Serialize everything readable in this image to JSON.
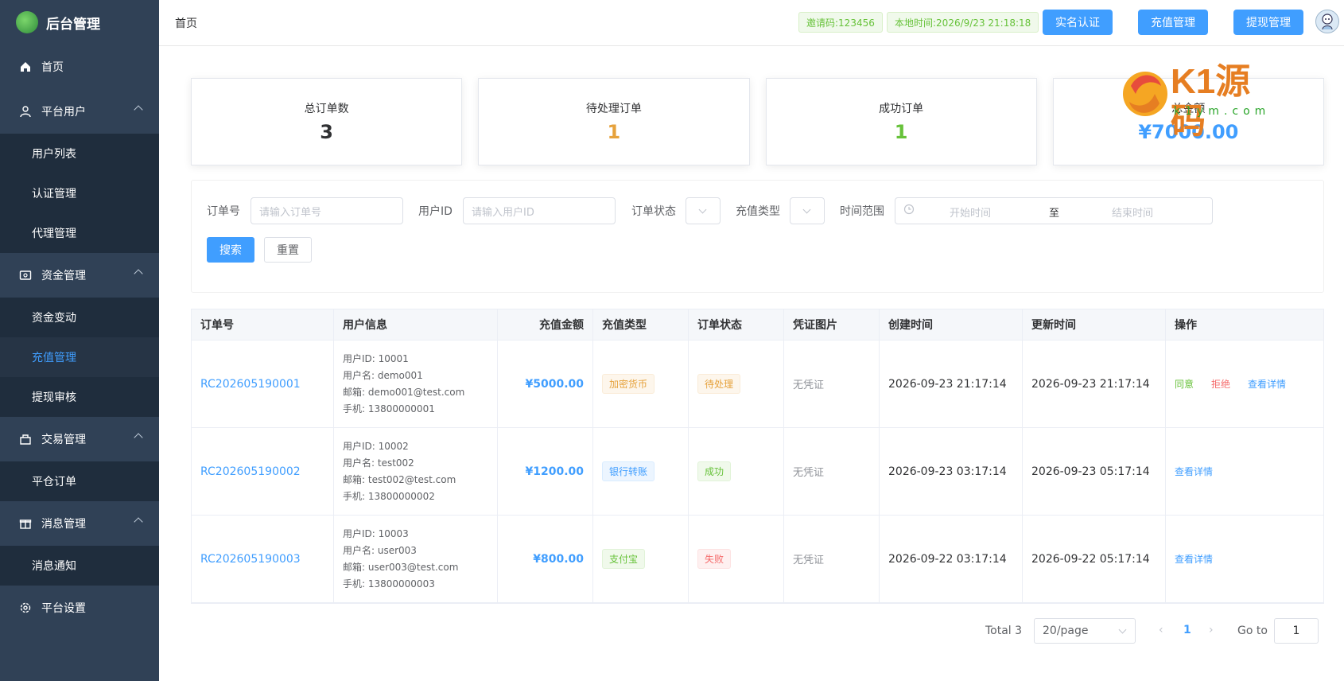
{
  "app": {
    "title": "后台管理"
  },
  "sidebar": {
    "items": [
      {
        "label": "首页"
      },
      {
        "label": "平台用户",
        "children": [
          "用户列表",
          "认证管理",
          "代理管理"
        ]
      },
      {
        "label": "资金管理",
        "children": [
          "资金变动",
          "充值管理",
          "提现审核"
        ]
      },
      {
        "label": "交易管理",
        "children": [
          "平仓订单"
        ]
      },
      {
        "label": "消息管理",
        "children": [
          "消息通知"
        ]
      },
      {
        "label": "平台设置"
      }
    ],
    "active": "充值管理"
  },
  "header": {
    "breadcrumb": "首页",
    "invite_code": "邀请码:123456",
    "local_time": "本地时间:2026/9/23 21:18:18",
    "buttons": {
      "verify": "实名认证",
      "recharge": "充值管理",
      "withdraw": "提现管理"
    }
  },
  "stats": [
    {
      "label": "总订单数",
      "value": "3",
      "color": "#303133"
    },
    {
      "label": "待处理订单",
      "value": "1",
      "color": "#e6a23c"
    },
    {
      "label": "成功订单",
      "value": "1",
      "color": "#67c23a"
    },
    {
      "label": "总金额",
      "value": "¥7000.00",
      "color": "#409eff"
    }
  ],
  "filters": {
    "order_no_label": "订单号",
    "order_no_placeholder": "请输入订单号",
    "user_id_label": "用户ID",
    "user_id_placeholder": "请输入用户ID",
    "status_label": "订单状态",
    "type_label": "充值类型",
    "time_label": "时间范围",
    "start_placeholder": "开始时间",
    "range_sep": "至",
    "end_placeholder": "结束时间",
    "search": "搜索",
    "reset": "重置"
  },
  "table": {
    "columns": [
      "订单号",
      "用户信息",
      "充值金额",
      "充值类型",
      "订单状态",
      "凭证图片",
      "创建时间",
      "更新时间",
      "操作"
    ],
    "rows": [
      {
        "order_no": "RC202605190001",
        "user_id": "用户ID: 10001",
        "username": "用户名: demo001",
        "email": "邮箱: demo001@test.com",
        "phone": "手机: 13800000001",
        "amount": "¥5000.00",
        "type": "加密货币",
        "status": "待处理",
        "proof": "无凭证",
        "created": "2026-09-23 21:17:14",
        "updated": "2026-09-23 21:17:14",
        "ops": [
          "同意",
          "拒绝",
          "查看详情"
        ]
      },
      {
        "order_no": "RC202605190002",
        "user_id": "用户ID: 10002",
        "username": "用户名: test002",
        "email": "邮箱: test002@test.com",
        "phone": "手机: 13800000002",
        "amount": "¥1200.00",
        "type": "银行转账",
        "status": "成功",
        "proof": "无凭证",
        "created": "2026-09-23 03:17:14",
        "updated": "2026-09-23 05:17:14",
        "ops": [
          "查看详情"
        ]
      },
      {
        "order_no": "RC202605190003",
        "user_id": "用户ID: 10003",
        "username": "用户名: user003",
        "email": "邮箱: user003@test.com",
        "phone": "手机: 13800000003",
        "amount": "¥800.00",
        "type": "支付宝",
        "status": "失败",
        "proof": "无凭证",
        "created": "2026-09-22 03:17:14",
        "updated": "2026-09-22 05:17:14",
        "ops": [
          "查看详情"
        ]
      }
    ]
  },
  "pagination": {
    "total": "Total 3",
    "page_size": "20/page",
    "current": "1",
    "goto_label": "Go to",
    "goto_value": "1"
  },
  "watermark": {
    "text": "K1源码",
    "sub": "k1ym.com"
  }
}
